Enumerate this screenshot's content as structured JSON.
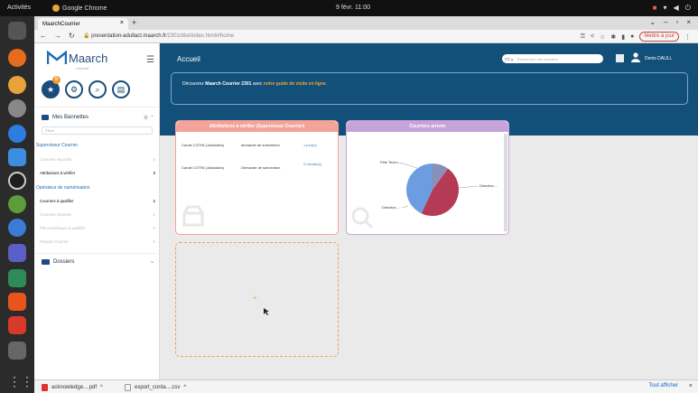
{
  "os": {
    "activities": "Activités",
    "app_name": "Google Chrome",
    "clock": "9 févr. 11:00"
  },
  "browser": {
    "tab_title": "MaarchCourrier",
    "url_host": "presentation-adullact.maarch.fr",
    "url_path": "/2301/dist/index.html#/home",
    "update_label": "Mettre à jour"
  },
  "sidebar": {
    "logo_text": "Maarch",
    "logo_sub": "Courrier",
    "badge": "6",
    "bannettes_title": "Mes Bannettes",
    "filter_placeholder": "Filtrer",
    "groups": [
      {
        "name": "Superviseur Courrier",
        "items": [
          {
            "label": "Courriers importés",
            "count": "0",
            "dim": true
          },
          {
            "label": "Attributions à vérifier",
            "count": "2",
            "dim": false
          }
        ]
      },
      {
        "name": "Opérateur de numérisation",
        "items": [
          {
            "label": "Courriers à qualifier",
            "count": "1",
            "dim": false
          },
          {
            "label": "Courriers importés",
            "count": "0",
            "dim": true
          },
          {
            "label": "Plis numériques à qualifier",
            "count": "0",
            "dim": true
          },
          {
            "label": "Retours Courrier",
            "count": "0",
            "dim": true
          }
        ]
      }
    ],
    "dossiers": "Dossiers"
  },
  "header": {
    "title": "Accueil",
    "search_placeholder": "Rechercher des courriers",
    "user": "Denis DAULL"
  },
  "banner": {
    "pre": "Découvrez ",
    "bold": "Maarch Courrier 2301",
    "mid": " avec ",
    "link": "notre guide de visite en ligne."
  },
  "attributions": {
    "title": "Attributions à vérifier (Superviseur Courrier)",
    "rows": [
      {
        "name": "Carole COTIN (Jokkolabs)",
        "subject": "demande de subvention",
        "time": "1 jour(s)"
      },
      {
        "name": "Carole COTIN (Jokkolabs)",
        "subject": "Demande de subvention",
        "time": "2 minute(s)"
      }
    ]
  },
  "arrivals": {
    "title": "Courriers arrivés"
  },
  "chart_data": {
    "type": "pie",
    "labels": [
      "Direction ...",
      "Direction ...",
      "Pôle Techn..."
    ],
    "values": [
      47,
      43,
      10
    ],
    "colors": [
      "#b53a55",
      "#6b9de0",
      "#8a8fb8"
    ]
  },
  "downloads": [
    {
      "name": "acknowledge....pdf",
      "type": "pdf"
    },
    {
      "name": "export_conta....csv",
      "type": "csv"
    }
  ],
  "downloads_show_all": "Tout afficher"
}
